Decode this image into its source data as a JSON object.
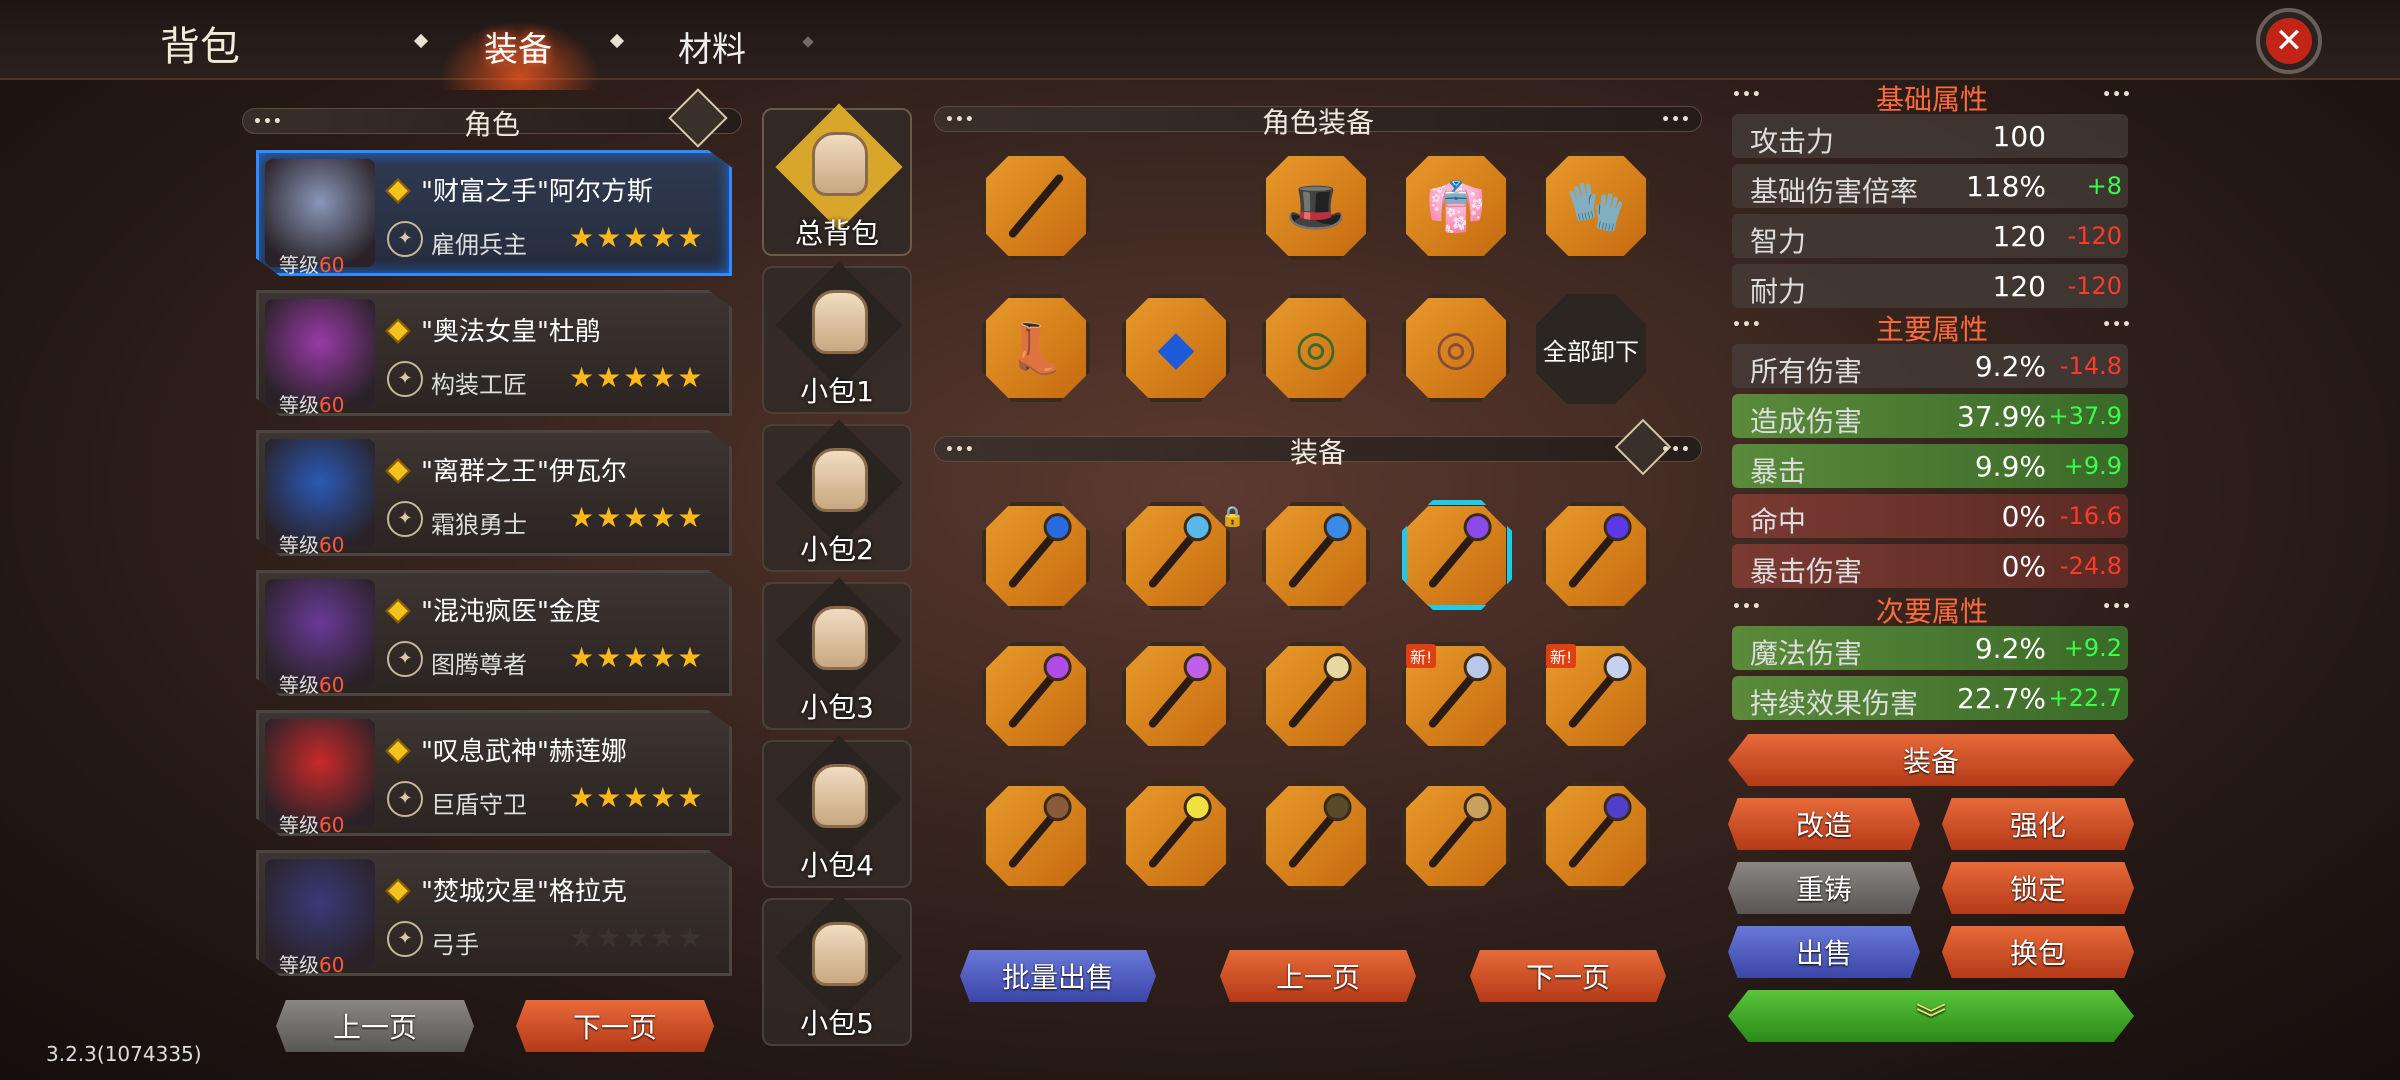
{
  "header": {
    "title": "背包",
    "tabs": [
      {
        "label": "装备",
        "active": true
      },
      {
        "label": "材料",
        "active": false
      }
    ]
  },
  "roles_panel": {
    "title": "角色",
    "roles": [
      {
        "name": "\"财富之手\"阿尔方斯",
        "class": "雇佣兵主",
        "level_label": "等级",
        "level": "60",
        "stars": "★★★★★",
        "selected": true,
        "portrait_color": "#8a98b8"
      },
      {
        "name": "\"奥法女皇\"杜鹃",
        "class": "构装工匠",
        "level_label": "等级",
        "level": "60",
        "stars": "★★★★★",
        "portrait_color": "#9a3aa8"
      },
      {
        "name": "\"离群之王\"伊瓦尔",
        "class": "霜狼勇士",
        "level_label": "等级",
        "level": "60",
        "stars": "★★★★★",
        "portrait_color": "#2a5ab8"
      },
      {
        "name": "\"混沌疯医\"金度",
        "class": "图腾尊者",
        "level_label": "等级",
        "level": "60",
        "stars": "★★★★★",
        "portrait_color": "#6a3a9a"
      },
      {
        "name": "\"叹息武神\"赫莲娜",
        "class": "巨盾守卫",
        "level_label": "等级",
        "level": "60",
        "stars": "★★★★★",
        "portrait_color": "#c82a2a"
      },
      {
        "name": "\"焚城灾星\"格拉克",
        "class": "弓手",
        "level_label": "等级",
        "level": "60",
        "stars": "★★★★★",
        "stars_dim": true,
        "portrait_color": "#3a3a7a"
      }
    ],
    "prev": "上一页",
    "next": "下一页"
  },
  "bags": [
    "总背包",
    "小包1",
    "小包2",
    "小包3",
    "小包4",
    "小包5"
  ],
  "equipped": {
    "title": "角色装备",
    "unequip_all": "全部卸下"
  },
  "inventory": {
    "title": "装备",
    "new_badge": "新!",
    "batch_sell": "批量出售",
    "prev": "上一页",
    "next": "下一页"
  },
  "stats": {
    "base_title": "基础属性",
    "base": [
      {
        "k": "攻击力",
        "v": "100",
        "d": ""
      },
      {
        "k": "基础伤害倍率",
        "v": "118%",
        "d": "+8",
        "t": "up"
      },
      {
        "k": "智力",
        "v": "120",
        "d": "-120",
        "t": "dn"
      },
      {
        "k": "耐力",
        "v": "120",
        "d": "-120",
        "t": "dn"
      }
    ],
    "main_title": "主要属性",
    "main": [
      {
        "k": "所有伤害",
        "v": "9.2%",
        "d": "-14.8",
        "t": "dn"
      },
      {
        "k": "造成伤害",
        "v": "37.9%",
        "d": "+37.9",
        "t": "up",
        "bg": "g"
      },
      {
        "k": "暴击",
        "v": "9.9%",
        "d": "+9.9",
        "t": "up",
        "bg": "g"
      },
      {
        "k": "命中",
        "v": "0%",
        "d": "-16.6",
        "t": "dn",
        "bg": "r"
      },
      {
        "k": "暴击伤害",
        "v": "0%",
        "d": "-24.8",
        "t": "dn",
        "bg": "r"
      }
    ],
    "sub_title": "次要属性",
    "sub": [
      {
        "k": "魔法伤害",
        "v": "9.2%",
        "d": "+9.2",
        "t": "up",
        "bg": "g"
      },
      {
        "k": "持续效果伤害",
        "v": "22.7%",
        "d": "+22.7",
        "t": "up",
        "bg": "g"
      }
    ]
  },
  "actions": {
    "equip": "装备",
    "modify": "改造",
    "enhance": "强化",
    "reforge": "重铸",
    "lock": "锁定",
    "sell": "出售",
    "swap_bag": "换包"
  },
  "version": "3.2.3(1074335)"
}
